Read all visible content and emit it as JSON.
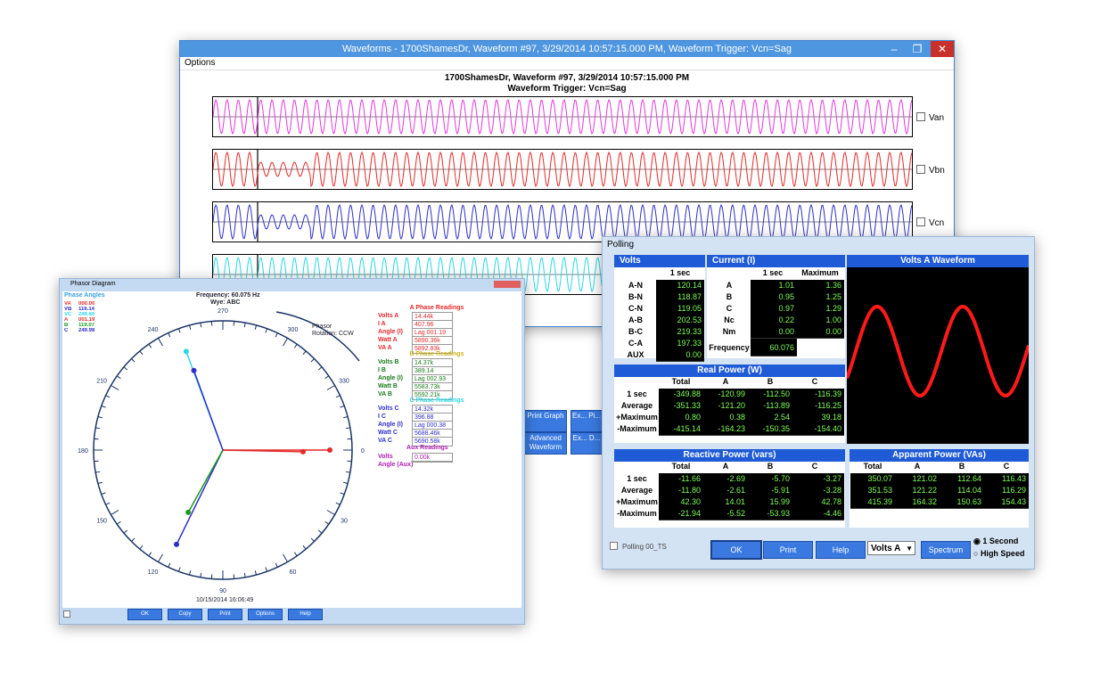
{
  "waveforms": {
    "title": "Waveforms - 1700ShamesDr, Waveform #97, 3/29/2014 10:57:15.000 PM, Waveform Trigger: Vcn=Sag",
    "menu": "Options",
    "header_line1": "1700ShamesDr, Waveform #97, 3/29/2014 10:57:15.000 PM",
    "header_line2": "Waveform Trigger: Vcn=Sag",
    "controls": [
      "–",
      "❐",
      "✕"
    ],
    "traces": [
      {
        "label": "Van",
        "color": "#e437e0"
      },
      {
        "label": "Vbn",
        "color": "#e42a2a"
      },
      {
        "label": "Vcn",
        "color": "#2e2ec8"
      },
      {
        "label": "",
        "color": "#2ad7e8"
      }
    ],
    "partial_buttons": [
      {
        "label": "Print Graph"
      },
      {
        "label": "Ex... Pi..."
      },
      {
        "label": "Advanced Waveform"
      },
      {
        "label": "Ex... D..."
      }
    ]
  },
  "polling": {
    "title": "Polling",
    "volts": {
      "title": "Volts",
      "col": "1 sec",
      "rows": [
        [
          "A-N",
          "120.14"
        ],
        [
          "B-N",
          "118.87"
        ],
        [
          "C-N",
          "119.05"
        ],
        [
          "A-B",
          "202.53"
        ],
        [
          "B-C",
          "219.33"
        ],
        [
          "C-A",
          "197.33"
        ],
        [
          "AUX",
          "0.00"
        ]
      ]
    },
    "current": {
      "title": "Current (I)",
      "cols": [
        "1 sec",
        "Maximum"
      ],
      "rows": [
        [
          "A",
          "1.01",
          "1.36"
        ],
        [
          "B",
          "0.95",
          "1.25"
        ],
        [
          "C",
          "0.97",
          "1.29"
        ],
        [
          "Nc",
          "0.22",
          "1.00"
        ],
        [
          "Nm",
          "0.00",
          "0.00"
        ]
      ],
      "freq_label": "Frequency",
      "freq_value": "60.076"
    },
    "volts_wave": {
      "title": "Volts A Waveform"
    },
    "real_power": {
      "title": "Real Power (W)",
      "cols": [
        "Total",
        "A",
        "B",
        "C"
      ],
      "rows": [
        [
          "1 sec",
          "-349.88",
          "-120.99",
          "-112.50",
          "-116.39"
        ],
        [
          "Average",
          "-351.33",
          "-121.20",
          "-113.89",
          "-116.25"
        ],
        [
          "+Maximum",
          "0.80",
          "0.38",
          "2.54",
          "39.18"
        ],
        [
          "-Maximum",
          "-415.14",
          "-164.23",
          "-150.35",
          "-154.40"
        ]
      ]
    },
    "reactive_power": {
      "title": "Reactive Power (vars)",
      "cols": [
        "Total",
        "A",
        "B",
        "C"
      ],
      "rows": [
        [
          "1 sec",
          "-11.66",
          "-2.69",
          "-5.70",
          "-3.27"
        ],
        [
          "Average",
          "-11.80",
          "-2.61",
          "-5.91",
          "-3.28"
        ],
        [
          "+Maximum",
          "42.30",
          "14.01",
          "15.99",
          "42.78"
        ],
        [
          "-Maximum",
          "-21.94",
          "-5.52",
          "-53.93",
          "-4.46"
        ]
      ]
    },
    "apparent_power": {
      "title": "Apparent Power (VAs)",
      "cols": [
        "Total",
        "A",
        "B",
        "C"
      ],
      "rows": [
        [
          "350.07",
          "121.02",
          "112.64",
          "116.43"
        ],
        [
          "351.53",
          "121.22",
          "114.04",
          "116.29"
        ],
        [
          "415.39",
          "164.32",
          "150.63",
          "154.43"
        ]
      ]
    },
    "footer": {
      "polling_check": "Polling 00_TS",
      "ok": "OK",
      "print": "Print",
      "help": "Help",
      "select_value": "Volts A",
      "spectrum": "Spectrum",
      "radio1": "1 Second",
      "radio2": "High Speed"
    }
  },
  "phasor": {
    "title": "Phasor Diagram",
    "frequency": "Frequency: 60.075 Hz",
    "wye": "Wye: ABC",
    "rotation": "Phasor\nRotation: CCW",
    "angles_title": "Phase Angles",
    "angles": [
      {
        "label": "VA",
        "value": "000.00",
        "color": "#e42a2a"
      },
      {
        "label": "VB",
        "value": "116.14",
        "color": "#2e2ec8"
      },
      {
        "label": "VC",
        "value": "249.60",
        "color": "#2ad7e8"
      },
      {
        "label": "A",
        "value": "001.19",
        "color": "#e42a2a"
      },
      {
        "label": "B",
        "value": "119.07",
        "color": "#1a9a1a"
      },
      {
        "label": "C",
        "value": "249.98",
        "color": "#2e2ec8"
      }
    ],
    "ticks": [
      "270",
      "300",
      "330",
      "0",
      "30",
      "60",
      "90",
      "120",
      "150",
      "180",
      "210",
      "240"
    ],
    "readings": {
      "a_title": "A Phase Readings",
      "a": [
        [
          "Volts A",
          "14.44k"
        ],
        [
          "I A",
          "407.96"
        ],
        [
          "Angle (I)",
          "Lag 001.19"
        ],
        [
          "Watt A",
          "5890.36k"
        ],
        [
          "VA A",
          "5892.83k"
        ]
      ],
      "b_title": "B Phase Readings",
      "b": [
        [
          "Volts B",
          "14.37k"
        ],
        [
          "I B",
          "389.14"
        ],
        [
          "Angle (I)",
          "Lag 002.93"
        ],
        [
          "Watt B",
          "5583.73k"
        ],
        [
          "VA B",
          "5592.21k"
        ]
      ],
      "c_title": "C Phase Readings",
      "c": [
        [
          "Volts C",
          "14.32k"
        ],
        [
          "I C",
          "396.88"
        ],
        [
          "Angle (I)",
          "Lag 000.38"
        ],
        [
          "Watt C",
          "5688.46k"
        ],
        [
          "VA C",
          "5690.58k"
        ]
      ],
      "aux_title": "Aux Readings",
      "aux": [
        [
          "Volts",
          "0.00k"
        ],
        [
          "Angle (Aux)",
          ""
        ]
      ]
    },
    "timestamp": "10/15/2014 16:06:49",
    "buttons": [
      "OK",
      "Copy",
      "Print",
      "Options",
      "Help"
    ]
  }
}
